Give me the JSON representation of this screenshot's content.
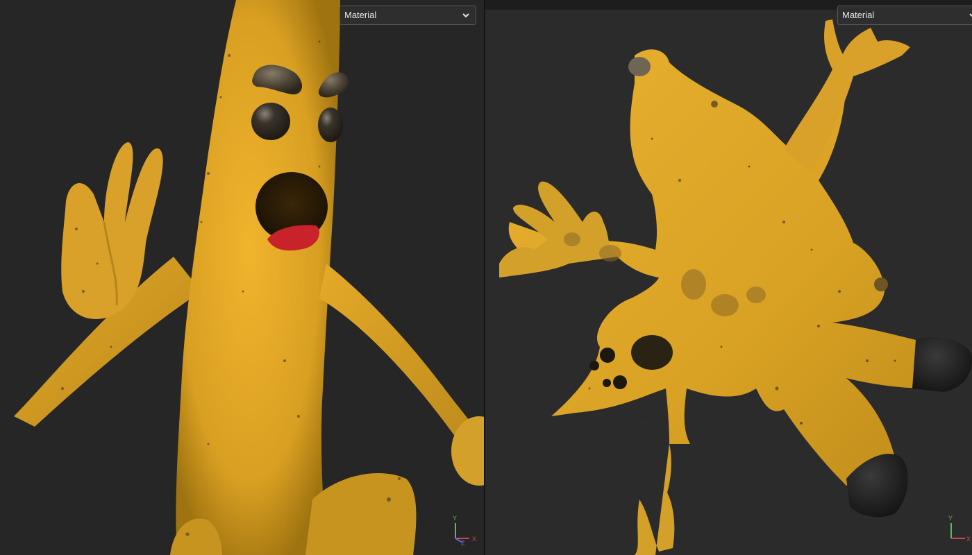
{
  "viewports": {
    "left": {
      "shading_mode": "Material",
      "gizmo": {
        "y_label": "Y",
        "x_label": "X",
        "z_label": "Z"
      }
    },
    "right": {
      "shading_mode": "Material",
      "gizmo": {
        "y_label": "Y",
        "x_label": "X"
      }
    }
  },
  "icons": {
    "dropdown": "chevron-down-icon",
    "axis": "axis-gizmo-icon"
  },
  "colors": {
    "banana_yellow": "#e0a826",
    "banana_dark": "#a87812",
    "viewport_bg_left": "#262626",
    "viewport_bg_right": "#2b2b2b",
    "tongue_red": "#c8222b",
    "eye_dark": "#2f2a22"
  }
}
